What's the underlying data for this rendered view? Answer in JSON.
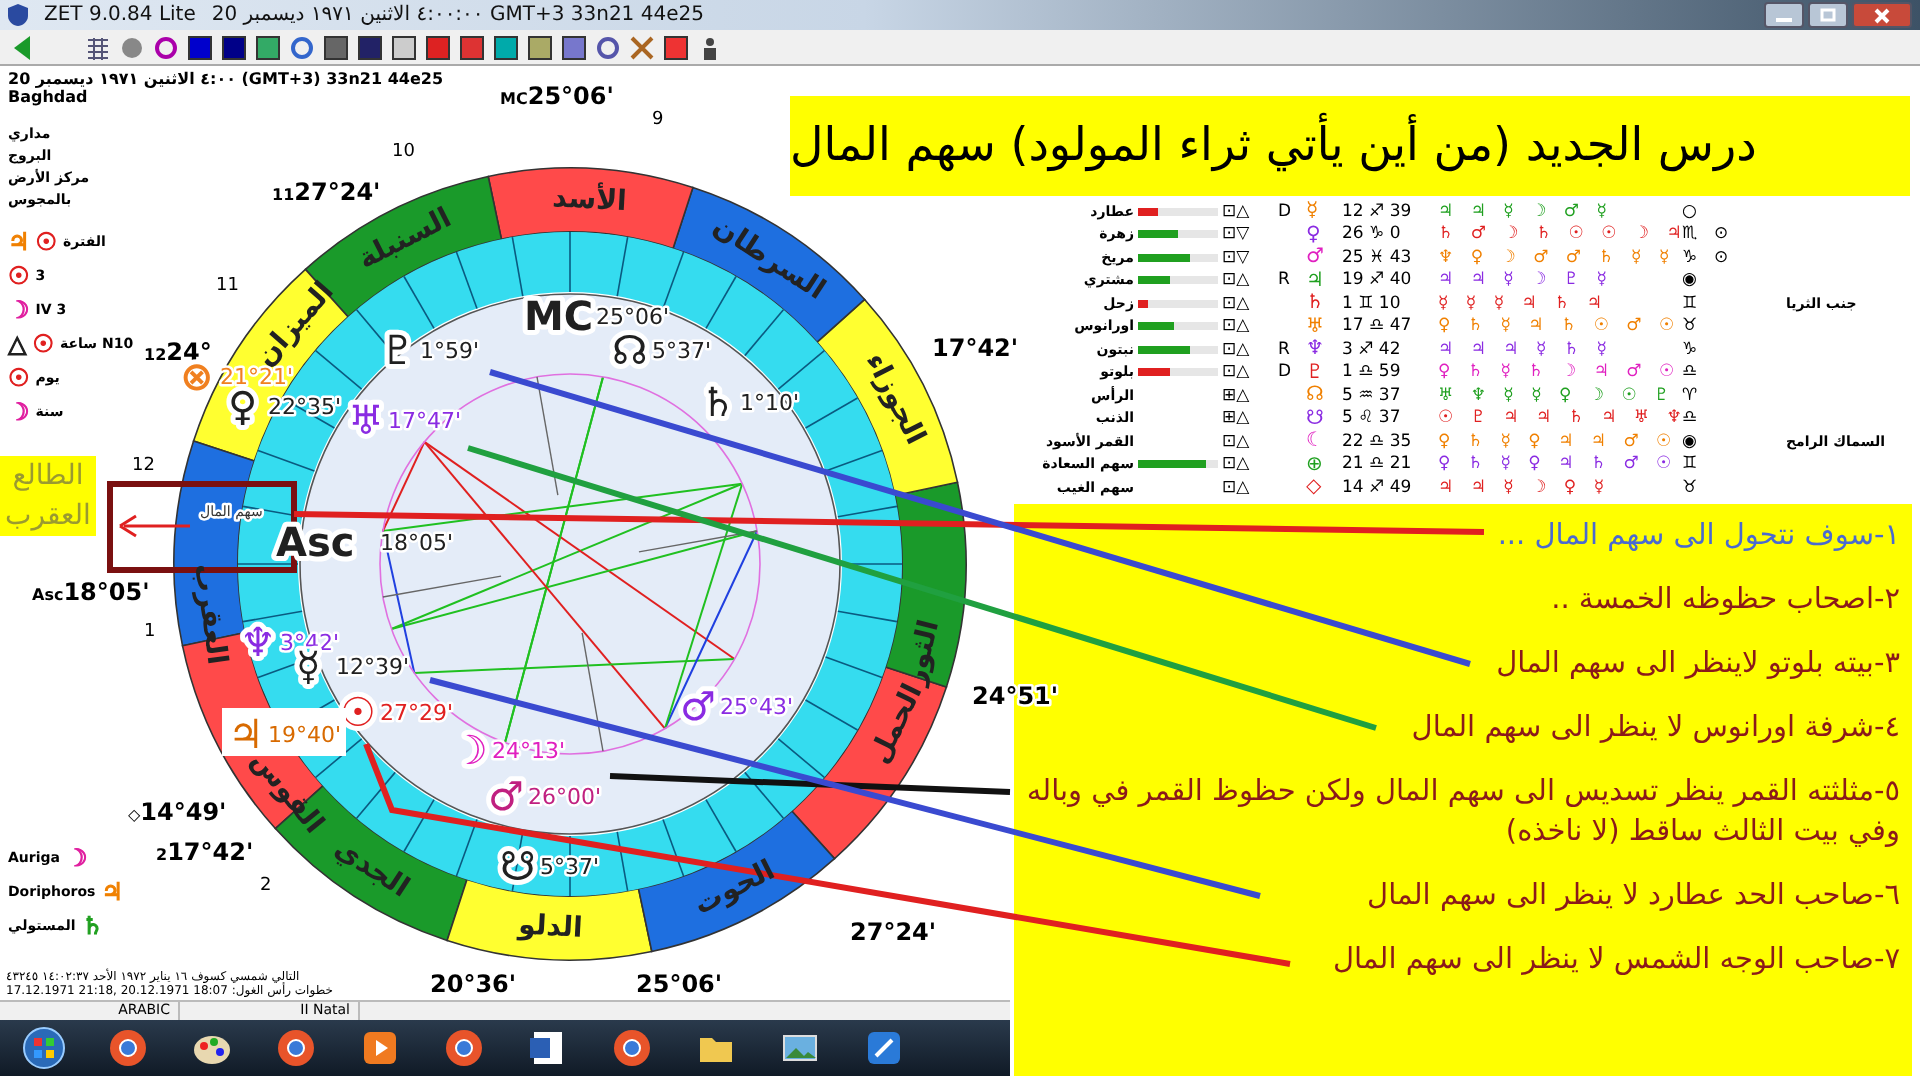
{
  "window": {
    "app": "ZET 9.0.84 Lite",
    "title": "20 ٤:٠٠:٠٠ الاثنين ١٩٧١ ديسمبر GMT+3 33n21 44e25"
  },
  "header": {
    "datetime": "20 ٤:٠٠ الاثنين ١٩٧١ ديسمبر (GMT+3) 33n21  44e25",
    "place": "Baghdad"
  },
  "settings": [
    "مداري",
    "البروج",
    "مركز الأرض",
    "بالمجوس"
  ],
  "periods": [
    {
      "text": "الفترة",
      "glyphs": [
        {
          "symbol": "☉",
          "color": "#e02020"
        },
        {
          "symbol": "♃",
          "color": "#f08000"
        }
      ]
    },
    {
      "text": "3",
      "glyphs": [
        {
          "symbol": "☉",
          "color": "#e02020"
        }
      ]
    },
    {
      "text": "3 IV",
      "glyphs": [
        {
          "symbol": "☽",
          "color": "#e020a0"
        }
      ]
    },
    {
      "text": "N10 ساعة",
      "glyphs": [
        {
          "symbol": "☉",
          "color": "#e02020"
        },
        {
          "symbol": "△",
          "color": "#202020"
        }
      ]
    },
    {
      "text": "يوم",
      "glyphs": [
        {
          "symbol": "☉",
          "color": "#e02020"
        }
      ]
    },
    {
      "text": "سنة",
      "glyphs": [
        {
          "symbol": "☽",
          "color": "#e020a0"
        }
      ]
    }
  ],
  "stars": [
    {
      "name": "Auriga",
      "symbol": "☽",
      "color": "#e020a0"
    },
    {
      "name": "Doriphoros",
      "symbol": "♃",
      "color": "#f08000"
    },
    {
      "name": "المستولي",
      "symbol": "♄",
      "color": "#20a020"
    }
  ],
  "footer": [
    "التالي شمسي كسوف ١٦ يناير ١٩٧٢ الأحد ١٤:٠٢:٣٧ ٤٣٢٤٥",
    "17.12.1971 21:18,  20.12.1971 18:07 :خطوات رأس الغول"
  ],
  "chart": {
    "signs": [
      {
        "name": "الحمل",
        "color": "#ff4a4a"
      },
      {
        "name": "الثور",
        "color": "#1a9a2a"
      },
      {
        "name": "الجوزاء",
        "color": "#ffff30"
      },
      {
        "name": "السرطان",
        "color": "#1e6fe0"
      },
      {
        "name": "الأسد",
        "color": "#ff4a4a"
      },
      {
        "name": "السنبلة",
        "color": "#1a9a2a"
      },
      {
        "name": "الميزان",
        "color": "#ffff30"
      },
      {
        "name": "العقرب",
        "color": "#1e6fe0"
      },
      {
        "name": "القوس",
        "color": "#ff4a4a"
      },
      {
        "name": "الجدي",
        "color": "#1a9a2a"
      },
      {
        "name": "الدلو",
        "color": "#ffff30"
      },
      {
        "name": "الحوت",
        "color": "#1e6fe0"
      }
    ],
    "houses": [
      "9",
      "10",
      "11",
      "12",
      "1",
      "2"
    ],
    "cusps": [
      {
        "prefix": "MC",
        "text": "25°06'"
      },
      {
        "prefix": "11",
        "text": "27°24'"
      },
      {
        "prefix": "12",
        "text": "24°"
      },
      {
        "prefix": "Asc",
        "text": "18°05'"
      },
      {
        "prefix": "◇",
        "text": "14°49'"
      },
      {
        "prefix": "2",
        "text": "17°42'"
      },
      {
        "text": "20°36'"
      },
      {
        "text": "25°06'"
      },
      {
        "text": "27°24'"
      },
      {
        "text": "24°51'"
      },
      {
        "text": "17°42'"
      }
    ],
    "planets": [
      {
        "glyph": "♇",
        "degree": "1°59'",
        "color": "#202020"
      },
      {
        "glyph": "MC",
        "degree": "25°06'",
        "color": "#202020"
      },
      {
        "glyph": "☊",
        "degree": "5°37'",
        "color": "#202020"
      },
      {
        "glyph": "♄",
        "degree": "1°10'",
        "color": "#202020"
      },
      {
        "glyph": "♅",
        "degree": "17°47'",
        "color": "#8a2be2"
      },
      {
        "glyph": "⊗",
        "degree": "21°21'",
        "color": "#f08020"
      },
      {
        "glyph": "♀",
        "degree": "22°35'",
        "color": "#202020"
      },
      {
        "glyph": "Asc",
        "degree": "18°05'",
        "color": "#202020"
      },
      {
        "glyph": "♆",
        "degree": "3°42'",
        "color": "#8a2be2"
      },
      {
        "glyph": "☿",
        "degree": "12°39'",
        "color": "#202020"
      },
      {
        "glyph": "☉",
        "degree": "27°29'",
        "color": "#e02020"
      },
      {
        "glyph": "☽",
        "degree": "24°13'",
        "color": "#e020c0"
      },
      {
        "glyph": "♃",
        "degree": "19°40'",
        "color": "#d86a00"
      },
      {
        "glyph": "♂",
        "degree": "26°00'",
        "color": "#c02080"
      },
      {
        "glyph": "☋",
        "degree": "5°37'",
        "color": "#202020"
      },
      {
        "glyph": "♂",
        "degree": "25°43'",
        "color": "#8a2be2"
      }
    ],
    "point_label": "سهم المال"
  },
  "asc_label": "الطالع العقرب",
  "banner": "درس الجديد (من أين يأتي ثراء المولود) سهم المال",
  "table": {
    "rows": [
      {
        "name": "عطارد",
        "bar": {
          "level": 0.25,
          "color": "#e02020"
        },
        "quality": "⊡△",
        "motion": "D",
        "glyph": "☿",
        "position": "12 ♐ 39",
        "rulers": "♃ ♃ ☿ ☽ ♂ ☿",
        "sign": "○"
      },
      {
        "name": "زهرة",
        "bar": {
          "level": 0.5,
          "color": "#20a020"
        },
        "quality": "⊡▽",
        "motion": "",
        "glyph": "♀",
        "position": "26 ♑ 0",
        "rulers": "♄ ♂ ☽ ♄ ☉ ☉ ☽ ♃",
        "sign": "♏",
        "extra": "⊙"
      },
      {
        "name": "مريخ",
        "bar": {
          "level": 0.65,
          "color": "#20a020"
        },
        "quality": "⊡▽",
        "motion": "",
        "glyph": "♂",
        "position": "25 ♓ 43",
        "rulers": "♆ ♀ ☽ ♂ ♂ ♄ ☿ ☿",
        "sign": "♑",
        "extra": "⊙"
      },
      {
        "name": "مشتري",
        "bar": {
          "level": 0.4,
          "color": "#20a020"
        },
        "quality": "⊡△",
        "motion": "R",
        "glyph": "♃",
        "position": "19 ♐ 40",
        "rulers": "♃ ♃ ☿ ☽ ♇ ☿",
        "sign": "◉"
      },
      {
        "name": "زحل",
        "bar": {
          "level": 0.12,
          "color": "#e02020"
        },
        "quality": "⊡△",
        "motion": "",
        "glyph": "♄",
        "position": "1 ♊ 10",
        "rulers": "☿ ☿ ☿ ♃ ♄ ♃",
        "sign": "♊",
        "note": "جنب الثريا"
      },
      {
        "name": "اورانوس",
        "bar": {
          "level": 0.45,
          "color": "#20a020"
        },
        "quality": "⊡△",
        "motion": "",
        "glyph": "♅",
        "position": "17 ♎ 47",
        "rulers": "♀ ♄ ☿ ♃ ♄ ☉ ♂ ☉",
        "sign": "♉"
      },
      {
        "name": "نبتون",
        "bar": {
          "level": 0.65,
          "color": "#20a020"
        },
        "quality": "⊡△",
        "motion": "R",
        "glyph": "♆",
        "position": "3 ♐ 42",
        "rulers": "♃ ♃ ♃ ☿ ♄ ☿",
        "sign": "♑"
      },
      {
        "name": "بلوتو",
        "bar": {
          "level": 0.4,
          "color": "#e02020"
        },
        "quality": "⊡△",
        "motion": "D",
        "glyph": "♇",
        "position": "1 ♎ 59",
        "rulers": "♀ ♄ ☿ ♄ ☽ ♃ ♂ ☉",
        "sign": "♎"
      },
      {
        "name": "الرأس",
        "quality": "⊞△",
        "motion": "",
        "glyph": "☊",
        "position": "5 ♒ 37",
        "rulers": "♅ ♆ ☿ ☿ ♀ ☽ ☉ ♇",
        "sign": "♈"
      },
      {
        "name": "الذنب",
        "quality": "⊞△",
        "motion": "",
        "glyph": "☋",
        "position": "5 ♌ 37",
        "rulers": "☉ ♇ ♃ ♃ ♄ ♃ ♅ ♆",
        "sign": "♎"
      },
      {
        "name": "القمر الأسود",
        "quality": "⊡△",
        "motion": "",
        "glyph": "☾",
        "position": "22 ♎ 35",
        "rulers": "♀ ♄ ☿ ♀ ♃ ♃ ♂ ☉",
        "sign": "◉",
        "note": "السماك الرامح"
      },
      {
        "name": "سهم السعادة",
        "bar": {
          "level": 0.85,
          "color": "#20a020"
        },
        "quality": "⊡△",
        "motion": "",
        "glyph": "⊕",
        "position": "21 ♎ 21",
        "rulers": "♀ ♄ ☿ ♀ ♃ ♄ ♂ ☉",
        "sign": "♊"
      },
      {
        "name": "سهم الغيب",
        "quality": "⊡△",
        "motion": "",
        "glyph": "◇",
        "position": "14 ♐ 49",
        "rulers": "♃ ♃ ☿ ☽ ♀ ☿",
        "sign": "♉"
      }
    ]
  },
  "notes": {
    "items": [
      {
        "text": "١-سوف نتحول الى سهم المال ...",
        "color": "#4a6ad0"
      },
      {
        "text": "٢-اصحاب حظوظه الخمسة ..",
        "color": "#8b1a1a"
      },
      {
        "text": "٣-بيته بلوتو لاينظر الى سهم المال",
        "color": "#8b1a1a"
      },
      {
        "text": "٤-شرفة اورانوس لا ينظر الى سهم المال",
        "color": "#8b1a1a"
      },
      {
        "text": "٥-مثلثته القمر ينظر تسديس الى سهم المال ولكن حظوظ القمر في وباله وفي بيت الثالث ساقط (لا ناخذه)",
        "color": "#8b1a1a"
      },
      {
        "text": "٦-صاحب الحد عطارد لا ينظر الى سهم المال",
        "color": "#8b1a1a"
      },
      {
        "text": "٧-صاحب الوجه الشمس لا ينظر الى سهم المال",
        "color": "#8b1a1a"
      }
    ]
  },
  "status_bar": [
    "II Natal",
    "ARABIC"
  ]
}
